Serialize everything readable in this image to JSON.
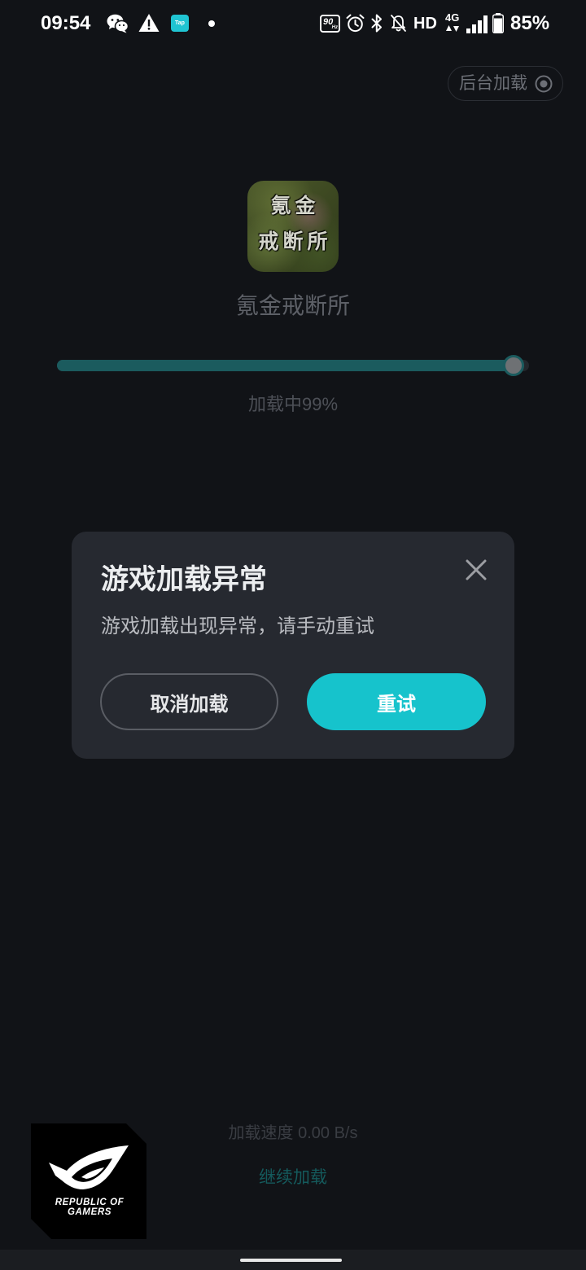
{
  "status_bar": {
    "time": "09:54",
    "taptap_label": "Tap",
    "refresh_rate": "90",
    "refresh_unit": "Hz",
    "hd_label": "HD",
    "network_type": "4G",
    "signal_level": 4,
    "battery_level": 0.85,
    "battery_text": "85%",
    "icons": [
      "wechat-icon",
      "warning-icon",
      "taptap-icon",
      "notification-dot-icon",
      "refresh-rate-icon",
      "alarm-icon",
      "bluetooth-icon",
      "notifications-off-icon",
      "hd-icon",
      "network-4g-icon",
      "signal-icon",
      "battery-icon"
    ]
  },
  "background_load": {
    "label": "后台加载",
    "icon": "radio-target-icon"
  },
  "app": {
    "icon_line_1": "氪金",
    "icon_line_2": "戒断所",
    "name": "氪金戒断所"
  },
  "progress": {
    "value": 0.99,
    "label": "加载中99%"
  },
  "dialog": {
    "title": "游戏加载异常",
    "message": "游戏加载出现异常，请手动重试",
    "close_icon": "close-icon",
    "cancel_label": "取消加载",
    "retry_label": "重试"
  },
  "footer": {
    "speed_text": "加载速度 0.00 B/s",
    "continue_label": "继续加载"
  },
  "branding": {
    "logo": "rog-logo",
    "logo_line_1": "REPUBLIC OF",
    "logo_line_2": "GAMERS"
  },
  "colors": {
    "background": "#111317",
    "accent": "#16c3cc",
    "dialog": "#262930",
    "progress_fill": "#1b5b5e",
    "continue_link": "#145a5c"
  }
}
